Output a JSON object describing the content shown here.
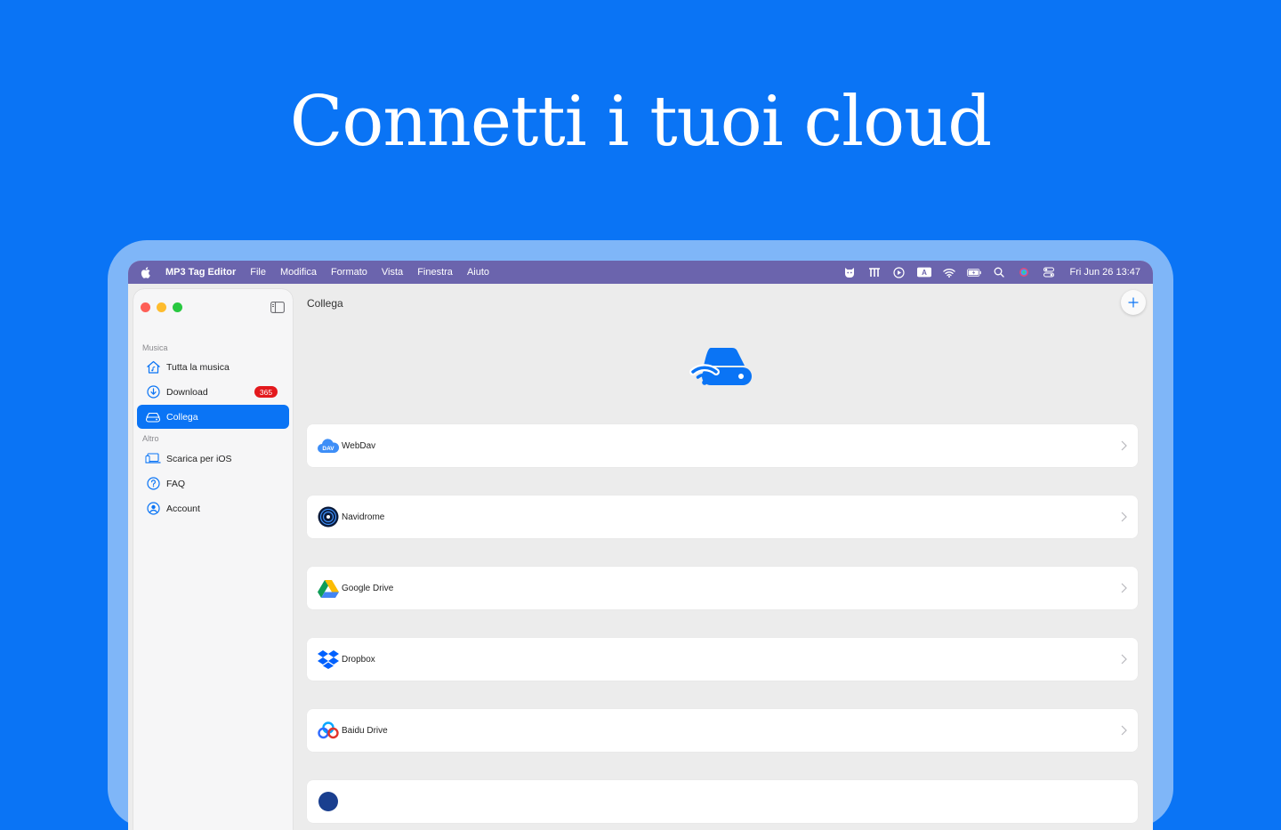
{
  "hero": {
    "title": "Connetti i tuoi cloud"
  },
  "menubar": {
    "app_name": "MP3 Tag Editor",
    "menus": [
      "File",
      "Modifica",
      "Formato",
      "Vista",
      "Finestra",
      "Aiuto"
    ],
    "clock": "Fri Jun 26  13:47"
  },
  "sidebar": {
    "sections": [
      {
        "label": "Musica",
        "items": [
          {
            "label": "Tutta la musica",
            "icon": "home-music-icon"
          },
          {
            "label": "Download",
            "icon": "download-icon",
            "badge": "365"
          },
          {
            "label": "Collega",
            "icon": "cloud-drive-icon",
            "active": true
          }
        ]
      },
      {
        "label": "Altro",
        "items": [
          {
            "label": "Scarica per iOS",
            "icon": "devices-icon"
          },
          {
            "label": "FAQ",
            "icon": "question-icon"
          },
          {
            "label": "Account",
            "icon": "account-icon"
          }
        ]
      }
    ]
  },
  "content": {
    "title": "Collega",
    "services": [
      {
        "label": "WebDav",
        "icon": "webdav-icon"
      },
      {
        "label": "Navidrome",
        "icon": "navidrome-icon"
      },
      {
        "label": "Google Drive",
        "icon": "google-drive-icon"
      },
      {
        "label": "Dropbox",
        "icon": "dropbox-icon"
      },
      {
        "label": "Baidu Drive",
        "icon": "baidu-drive-icon"
      }
    ]
  },
  "colors": {
    "background": "#0a74f5",
    "accent": "#0a74f5",
    "menubar": "#6b64ad",
    "badge": "#e3191d"
  }
}
